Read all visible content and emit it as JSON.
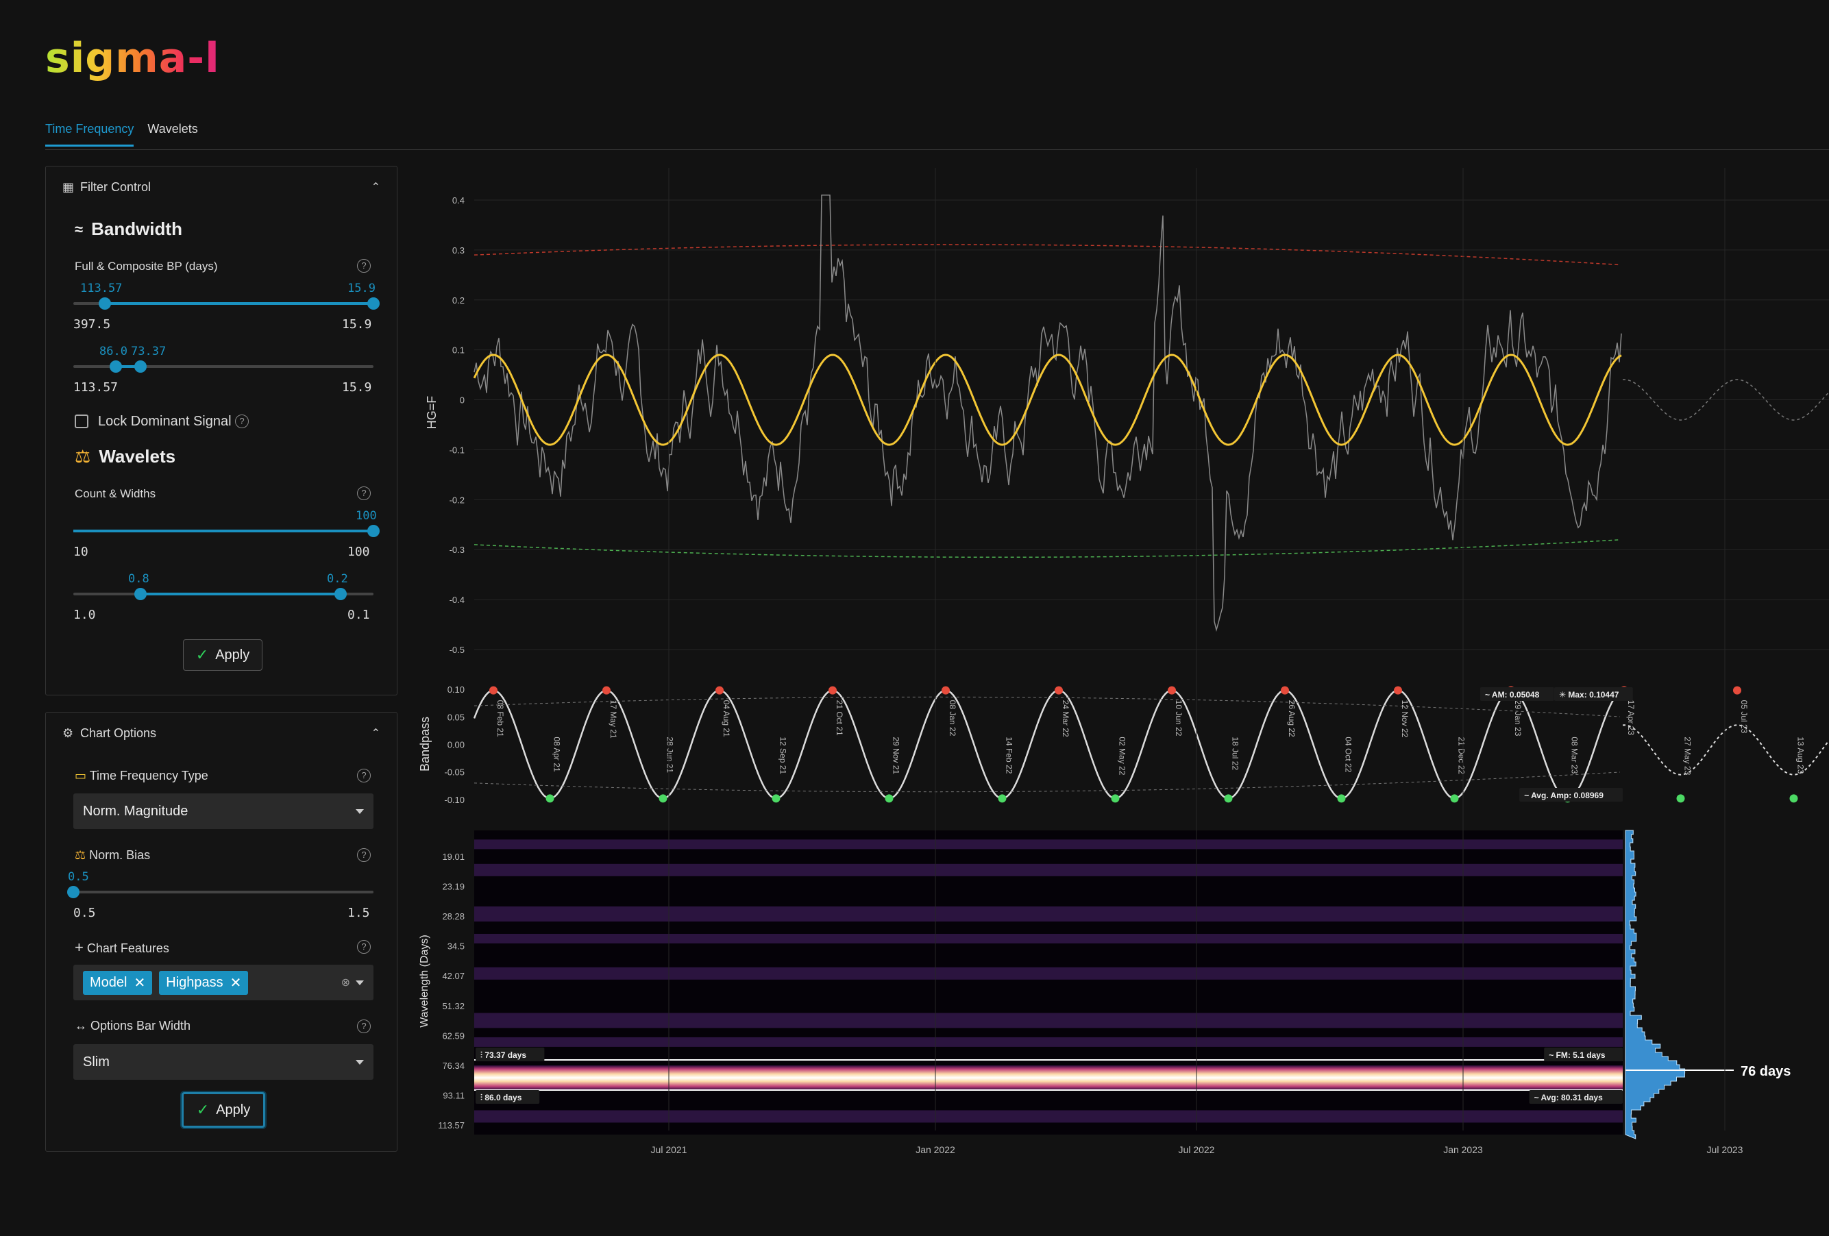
{
  "app": {
    "logo": "sigma-l"
  },
  "tabs": [
    {
      "label": "Time Frequency",
      "active": true
    },
    {
      "label": "Wavelets",
      "active": false
    }
  ],
  "filter_control": {
    "title": "Filter Control",
    "bandwidth": {
      "title": "Bandwidth",
      "full_label": "Full & Composite BP (days)",
      "slider1": {
        "lo": "113.57",
        "hi": "15.9",
        "min": "397.5",
        "max": "15.9"
      },
      "slider2": {
        "lo": "86.0",
        "hi": "73.37",
        "min": "113.57",
        "max": "15.9"
      },
      "lock_label": "Lock Dominant Signal"
    },
    "wavelets": {
      "title": "Wavelets",
      "count_label": "Count & Widths",
      "slider1": {
        "hi": "100",
        "min": "10",
        "max": "100"
      },
      "slider2": {
        "lo": "0.8",
        "hi": "0.2",
        "min": "1.0",
        "max": "0.1"
      }
    },
    "apply_label": "Apply"
  },
  "chart_options": {
    "title": "Chart Options",
    "tf_type_label": "Time Frequency Type",
    "tf_type_value": "Norm. Magnitude",
    "norm_bias_label": "Norm. Bias",
    "norm_bias": {
      "value": "0.5",
      "min": "0.5",
      "max": "1.5"
    },
    "features_label": "Chart Features",
    "features": [
      "Model",
      "Highpass"
    ],
    "bar_width_label": "Options Bar Width",
    "bar_width_value": "Slim",
    "apply_label": "Apply"
  },
  "chart_data": [
    {
      "type": "line",
      "ylabel": "HG=F",
      "yticks": [
        0.4,
        0.3,
        0.2,
        0.1,
        0,
        -0.1,
        -0.2,
        -0.3,
        -0.4,
        -0.5
      ],
      "ylim": [
        -0.5,
        0.4
      ],
      "x_ticks": [
        "Jul 2021",
        "Jan 2022",
        "Jul 2022",
        "Jan 2023",
        "Jul 2023"
      ],
      "series": [
        {
          "values_desc": "noisy highpass",
          "color": "#8a8a8a"
        },
        {
          "values_desc": "composite bandpass sine, period ~76 days",
          "amplitude": 0.09,
          "color": "#f3c634"
        }
      ],
      "upper_envelope": [
        0.29,
        0.32,
        0.27
      ],
      "lower_envelope": [
        -0.29,
        -0.325,
        -0.28
      ]
    },
    {
      "type": "line",
      "ylabel": "Bandpass",
      "yticks": [
        "0.10",
        "0.05",
        "0.00",
        "-0.05",
        "-0.10"
      ],
      "ylim": [
        -0.11,
        0.11
      ],
      "peaks": [
        "08 Feb 21",
        "17 May 21",
        "04 Aug 21",
        "21 Oct 21",
        "08 Jan 22",
        "24 Mar 22",
        "10 Jun 22",
        "26 Aug 22",
        "12 Nov 22",
        "29 Jan 23",
        "17 Apr 23",
        "05 Jul 23"
      ],
      "troughs": [
        "08 Apr 21",
        "28 Jun 21",
        "12 Sep 21",
        "29 Nov 21",
        "14 Feb 22",
        "02 May 22",
        "18 Jul 22",
        "04 Oct 22",
        "21 Dec 22",
        "08 Mar 23",
        "27 May 23",
        "13 Aug 23"
      ],
      "annotations": {
        "am": "AM: 0.05048",
        "max": "Max: 0.10447",
        "avg_amp": "Avg. Amp: 0.08969"
      }
    },
    {
      "type": "heatmap",
      "ylabel": "Wavelength (Days)",
      "yticks": [
        "19.01",
        "23.19",
        "28.28",
        "34.5",
        "42.07",
        "51.32",
        "62.59",
        "76.34",
        "93.11",
        "113.57"
      ],
      "annotations": {
        "top": "73.37 days",
        "bottom": "86.0 days",
        "fm": "FM: 5.1 days",
        "avg": "Avg: 80.31 days",
        "peak": "76 days"
      }
    }
  ]
}
